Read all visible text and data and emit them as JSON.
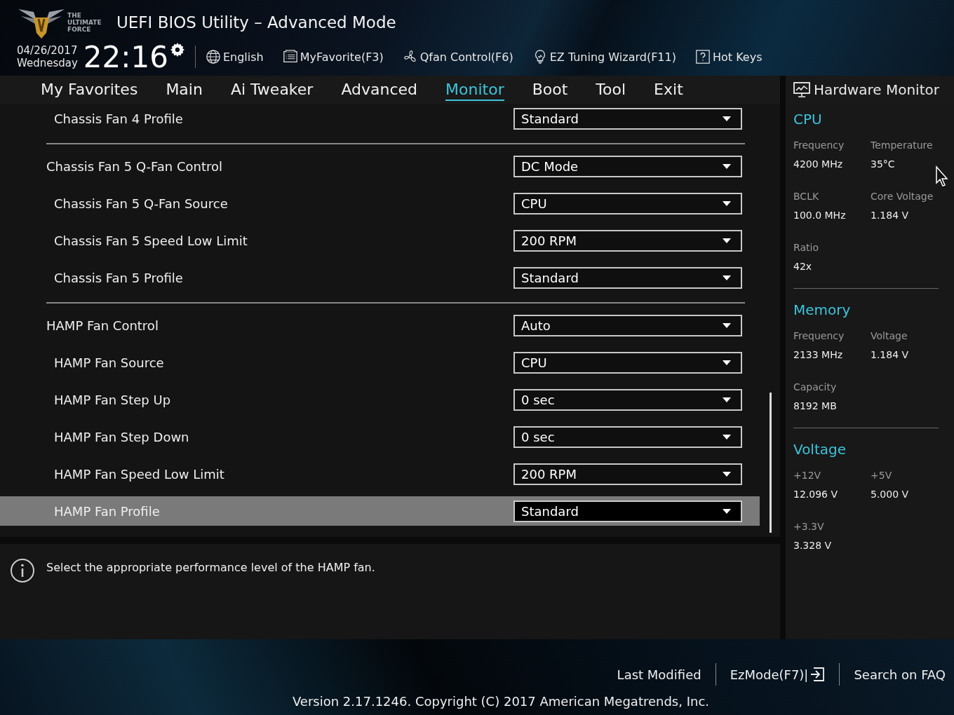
{
  "header": {
    "logo_text": "THE ULTIMATE FORCE",
    "title": "UEFI BIOS Utility – Advanced Mode",
    "date": "04/26/2017",
    "weekday": "Wednesday",
    "time": "22:16",
    "tools": [
      {
        "kind": "language",
        "label": "English"
      },
      {
        "kind": "favorite",
        "label": "MyFavorite(F3)"
      },
      {
        "kind": "fan",
        "label": "Qfan Control(F6)"
      },
      {
        "kind": "wizard",
        "label": "EZ Tuning Wizard(F11)"
      },
      {
        "kind": "help",
        "label": "Hot Keys"
      }
    ]
  },
  "tabs": [
    {
      "label": "My Favorites",
      "selected": false
    },
    {
      "label": "Main",
      "selected": false
    },
    {
      "label": "Ai Tweaker",
      "selected": false
    },
    {
      "label": "Advanced",
      "selected": false
    },
    {
      "label": "Monitor",
      "selected": true
    },
    {
      "label": "Boot",
      "selected": false
    },
    {
      "label": "Tool",
      "selected": false
    },
    {
      "label": "Exit",
      "selected": false
    }
  ],
  "settings": [
    {
      "children": [
        {
          "label": "Chassis Fan 4 Profile",
          "value": "Standard",
          "selected": false
        }
      ]
    },
    {
      "label": "Chassis Fan 5 Q-Fan Control",
      "value": "DC Mode",
      "selected": false,
      "children": [
        {
          "label": "Chassis Fan 5 Q-Fan Source",
          "value": "CPU",
          "selected": false
        },
        {
          "label": "Chassis Fan 5 Speed Low Limit",
          "value": "200 RPM",
          "selected": false
        },
        {
          "label": "Chassis Fan 5 Profile",
          "value": "Standard",
          "selected": false
        }
      ]
    },
    {
      "label": "HAMP Fan Control",
      "value": "Auto",
      "selected": false,
      "children": [
        {
          "label": "HAMP Fan Source",
          "value": "CPU",
          "selected": false
        },
        {
          "label": "HAMP Fan Step Up",
          "value": "0 sec",
          "selected": false
        },
        {
          "label": "HAMP Fan Step Down",
          "value": "0 sec",
          "selected": false
        },
        {
          "label": "HAMP Fan Speed Low Limit",
          "value": "200 RPM",
          "selected": false
        },
        {
          "label": "HAMP Fan Profile",
          "value": "Standard",
          "selected": true
        }
      ]
    }
  ],
  "help_text": "Select the appropriate performance level of the HAMP fan.",
  "hardware_monitor": {
    "title": "Hardware Monitor",
    "sections": [
      {
        "title": "CPU",
        "fields": [
          {
            "label": "Frequency",
            "value": "4200 MHz"
          },
          {
            "label": "Temperature",
            "value": "35°C"
          },
          {
            "label": "BCLK",
            "value": "100.0 MHz"
          },
          {
            "label": "Core Voltage",
            "value": "1.184 V"
          },
          {
            "label": "Ratio",
            "value": "42x"
          }
        ]
      },
      {
        "title": "Memory",
        "fields": [
          {
            "label": "Frequency",
            "value": "2133 MHz"
          },
          {
            "label": "Voltage",
            "value": "1.184 V"
          },
          {
            "label": "Capacity",
            "value": "8192 MB"
          }
        ]
      },
      {
        "title": "Voltage",
        "fields": [
          {
            "label": "+12V",
            "value": "12.096 V"
          },
          {
            "label": "+5V",
            "value": "5.000 V"
          },
          {
            "label": "+3.3V",
            "value": "3.328 V"
          }
        ]
      }
    ]
  },
  "footer": {
    "links": [
      {
        "kind": "plain",
        "label": "Last Modified"
      },
      {
        "kind": "exit",
        "label": "EzMode(F7)|"
      },
      {
        "kind": "plain",
        "label": "Search on FAQ"
      }
    ],
    "version": "Version 2.17.1246. Copyright (C) 2017 American Megatrends, Inc."
  }
}
